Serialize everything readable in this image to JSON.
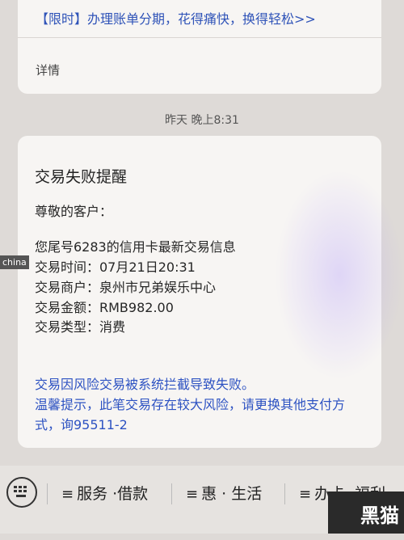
{
  "promo_card": {
    "text": "【限时】办理账单分期，花得痛快，换得轻松>>",
    "details": "详情"
  },
  "timestamp": "昨天 晚上8:31",
  "message": {
    "title": "交易失败提醒",
    "greeting": "尊敬的客户：",
    "intro": "您尾号6283的信用卡最新交易信息",
    "time": "交易时间：07月21日20:31",
    "merchant": "交易商户：泉州市兄弟娱乐中心",
    "amount": "交易金额：RMB982.00",
    "type": "交易类型：消费",
    "failure": "交易因风险交易被系统拦截导致失败。",
    "tip_line1": "温馨提示，此笔交易存在较大风险，请更换其他支付方",
    "tip_line2": "式，询95511-2"
  },
  "bottom_menu": {
    "keyboard_icon": "keyboard-icon",
    "items": [
      {
        "icon": "≡",
        "label": "服务 ·借款"
      },
      {
        "icon": "≡",
        "label": "惠 · 生活"
      },
      {
        "icon": "≡",
        "label": "办卡· 福利"
      }
    ]
  },
  "watermark": {
    "left": "china",
    "right": "黑猫"
  }
}
